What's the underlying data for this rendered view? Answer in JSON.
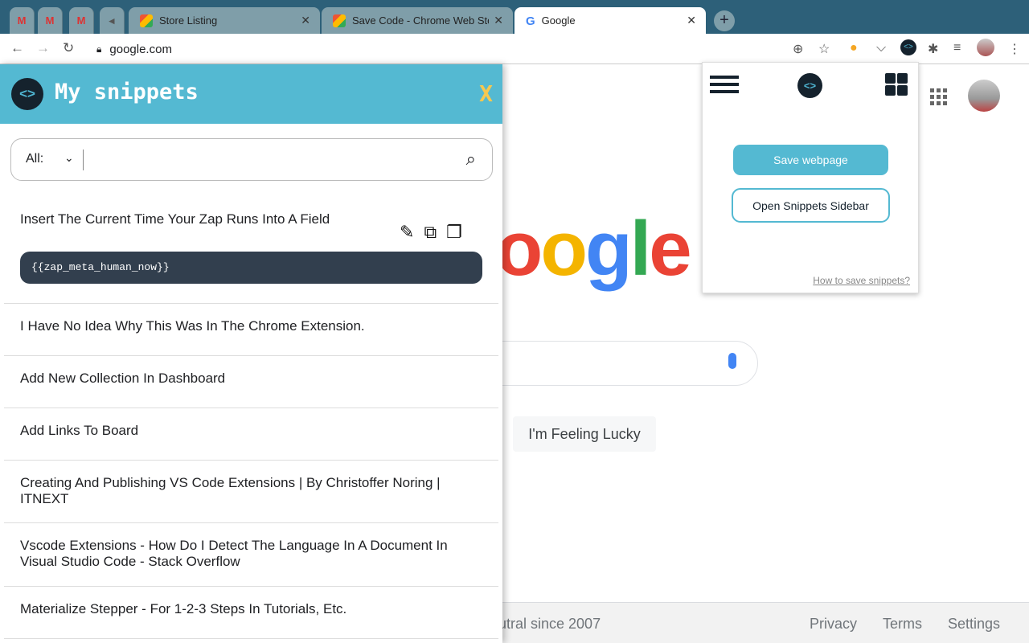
{
  "browser": {
    "tabs": [
      {
        "label": "",
        "icon": "gmail-icon"
      },
      {
        "label": "",
        "icon": "gmail-icon"
      },
      {
        "label": "",
        "icon": "gmail-icon"
      },
      {
        "label": "",
        "icon": "muted-speaker-icon"
      },
      {
        "label": "Store Listing",
        "icon": "chrome-web-store-icon"
      },
      {
        "label": "Save Code - Chrome Web Store",
        "icon": "chrome-web-store-icon"
      },
      {
        "label": "Google",
        "icon": "google-icon",
        "active": true
      }
    ],
    "url": "google.com"
  },
  "google": {
    "logo": "Google",
    "lucky": "I'm Feeling Lucky",
    "footer": {
      "left": "utral since 2007",
      "privacy": "Privacy",
      "terms": "Terms",
      "settings": "Settings"
    }
  },
  "sidebar": {
    "title": "My snippets",
    "close": "X",
    "filter": "All:",
    "search_placeholder": "",
    "accent": "#54b9d2",
    "snippets": [
      {
        "title": "Insert The Current Time Your Zap Runs Into A Field",
        "code": "{{zap_meta_human_now}}"
      },
      {
        "title": "I Have No Idea Why This Was In The Chrome Extension."
      },
      {
        "title": "Add New Collection In Dashboard"
      },
      {
        "title": "Add Links To Board"
      },
      {
        "title": "Creating And Publishing VS Code Extensions | By Christoffer Noring | ITNEXT"
      },
      {
        "title": "Vscode Extensions - How Do I Detect The Language In A Document In Visual Studio Code - Stack Overflow"
      },
      {
        "title": "Materialize Stepper - For 1-2-3 Steps In Tutorials, Etc."
      }
    ]
  },
  "popup": {
    "save": "Save webpage",
    "open": "Open Snippets Sidebar",
    "howto": "How to save snippets?"
  }
}
